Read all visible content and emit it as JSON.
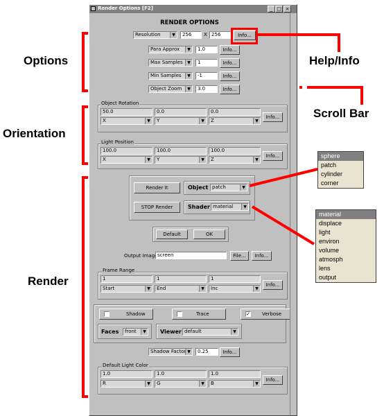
{
  "window": {
    "title": "Render Options [F2]",
    "heading": "RENDER OPTIONS",
    "title_buttons": [
      "_",
      "□",
      "×"
    ]
  },
  "options": {
    "resolution_dropdown": "Resolution",
    "res_x": "256",
    "res_x_sep": "X",
    "res_y": "256",
    "info_label": "Info...",
    "rows": [
      {
        "dropdown": "Para Approx",
        "value": "1.0"
      },
      {
        "dropdown": "Max Samples",
        "value": "1"
      },
      {
        "dropdown": "Min Samples",
        "value": "-1"
      },
      {
        "dropdown": "Object Zoom",
        "value": "3.0"
      }
    ]
  },
  "orientation": {
    "object_rotation": {
      "label": "Object Rotation",
      "values": [
        "50.0",
        "0.0",
        "0.0"
      ],
      "axes": [
        "X",
        "Y",
        "Z"
      ]
    },
    "light_position": {
      "label": "Light Position",
      "values": [
        "100.0",
        "100.0",
        "100.0"
      ],
      "axes": [
        "X",
        "Y",
        "Z"
      ]
    }
  },
  "render": {
    "render_it": "Render It",
    "object_label": "Object",
    "object_value": "patch",
    "stop_render": "STOP Render",
    "shader_label": "Shader",
    "shader_value": "material",
    "default_label": "Default",
    "ok_label": "OK",
    "output_label": "Output Image",
    "output_value": "screen",
    "file_label": "File...",
    "frame_range": {
      "label": "Frame Range",
      "values": [
        "1",
        "1",
        "1"
      ],
      "selects": [
        "Start",
        "End",
        "Inc"
      ]
    },
    "shadow_label": "Shadow",
    "trace_label": "Trace",
    "verbose_label": "Verbose",
    "verbose_check": "✓",
    "faces_label": "Faces",
    "faces_value": "front",
    "viewer_label": "Viewer",
    "viewer_value": "default",
    "shadow_factor_dropdown": "Shadow Factor",
    "shadow_factor_value": "0.25",
    "light_color": {
      "label": "Default Light Color",
      "values": [
        "1.0",
        "1.0",
        "1.0"
      ],
      "selects": [
        "R",
        "G",
        "B"
      ]
    }
  },
  "annotations": {
    "options": "Options",
    "orientation": "Orientation",
    "render": "Render",
    "help_info": "Help/Info",
    "scroll_bar": "Scroll Bar"
  },
  "object_list": [
    "sphere",
    "patch",
    "cylinder",
    "corner"
  ],
  "object_list_selected": 0,
  "shader_list": [
    "material",
    "displace",
    "light",
    "environ",
    "volume",
    "atmosph",
    "lens",
    "output"
  ],
  "shader_list_selected": 0,
  "colors": {
    "window": "#c0c0c0",
    "annotation": "#ff0000",
    "titlebar": "#808080",
    "popup": "#e8e4d0"
  }
}
